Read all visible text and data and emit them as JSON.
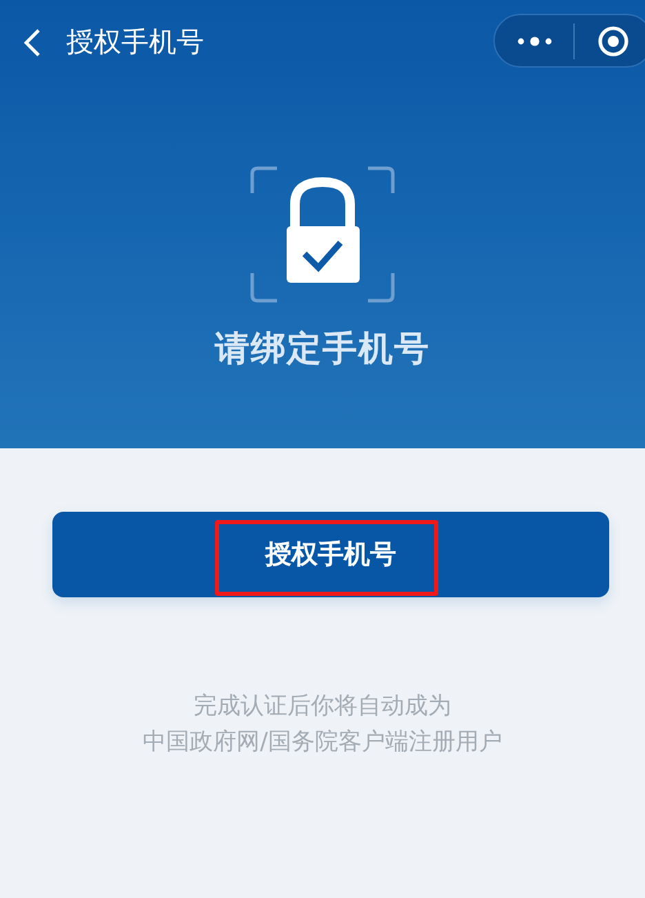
{
  "nav_bar": {
    "title": "授权手机号"
  },
  "header": {
    "heading": "请绑定手机号"
  },
  "authorize_button": {
    "label": "授权手机号",
    "highlighted": true
  },
  "note_lines": [
    "完成认证后你将自动成为",
    "中国政府网/国务院客户端注册用户"
  ]
}
